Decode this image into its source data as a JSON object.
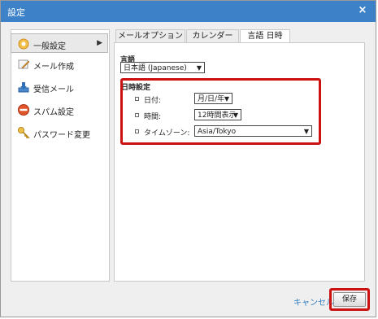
{
  "dialog": {
    "title": "設定",
    "close_icon": "close-icon"
  },
  "sidebar": {
    "items": [
      {
        "label": "一般設定",
        "icon": "gear-icon",
        "active": true
      },
      {
        "label": "メール作成",
        "icon": "compose-icon"
      },
      {
        "label": "受信メール",
        "icon": "inbox-download-icon"
      },
      {
        "label": "スパム設定",
        "icon": "no-entry-icon"
      },
      {
        "label": "パスワード変更",
        "icon": "key-icon"
      }
    ]
  },
  "tabs": [
    {
      "label": "メールオプション"
    },
    {
      "label": "カレンダー"
    },
    {
      "label": "言語 日時",
      "active": true
    }
  ],
  "language": {
    "label": "言語",
    "value": "日本語 (Japanese)"
  },
  "datetime": {
    "heading": "日時設定",
    "date_label": "日付:",
    "date_value": "月/日/年",
    "time_label": "時間:",
    "time_value": "12時間表示",
    "timezone_label": "タイムゾーン:",
    "timezone_value": "Asia/Tokyo"
  },
  "footer": {
    "cancel_label": "キャンセル",
    "save_label": "保存"
  },
  "colors": {
    "titlebar": "#3d82c8",
    "highlight": "#cc1111",
    "link": "#2f7fc1"
  }
}
